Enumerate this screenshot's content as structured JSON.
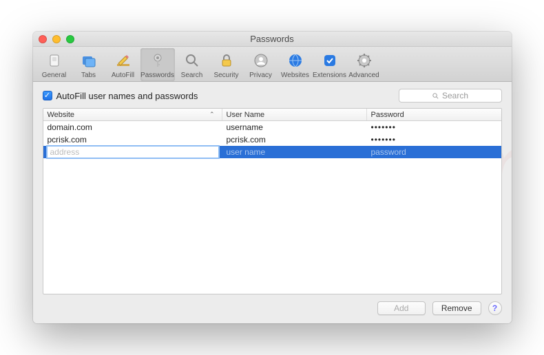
{
  "window": {
    "title": "Passwords"
  },
  "toolbar": {
    "items": [
      {
        "id": "general",
        "label": "General"
      },
      {
        "id": "tabs",
        "label": "Tabs"
      },
      {
        "id": "autofill",
        "label": "AutoFill"
      },
      {
        "id": "passwords",
        "label": "Passwords",
        "active": true
      },
      {
        "id": "search",
        "label": "Search"
      },
      {
        "id": "security",
        "label": "Security"
      },
      {
        "id": "privacy",
        "label": "Privacy"
      },
      {
        "id": "websites",
        "label": "Websites"
      },
      {
        "id": "extensions",
        "label": "Extensions"
      },
      {
        "id": "advanced",
        "label": "Advanced"
      }
    ]
  },
  "checkbox": {
    "label": "AutoFill user names and passwords",
    "checked": true
  },
  "search": {
    "placeholder": "Search"
  },
  "columns": {
    "website": "Website",
    "username": "User Name",
    "password": "Password"
  },
  "rows": [
    {
      "website": "domain.com",
      "username": "username",
      "password": "•••••••"
    },
    {
      "website": "pcrisk.com",
      "username": "pcrisk.com",
      "password": "•••••••"
    }
  ],
  "editing": {
    "website_placeholder": "address",
    "username_placeholder": "user name",
    "password_placeholder": "password"
  },
  "buttons": {
    "add": "Add",
    "remove": "Remove",
    "help": "?"
  },
  "watermark": "pcrisk.com"
}
